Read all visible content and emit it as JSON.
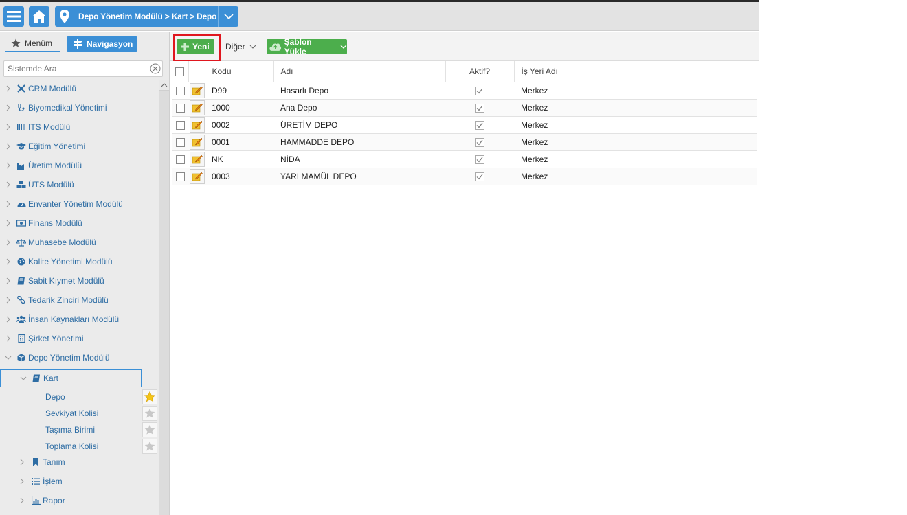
{
  "topbar": {
    "breadcrumb": "Depo Yönetim Modülü > Kart > Depo"
  },
  "sidebar": {
    "tab_menu": "Menüm",
    "tab_nav": "Navigasyon",
    "search_placeholder": "Sistemde Ara",
    "modules": [
      {
        "label": "CRM Modülü",
        "icon": "crm-icon"
      },
      {
        "label": "Biyomedikal Yönetimi",
        "icon": "stethoscope-icon"
      },
      {
        "label": "ITS Modülü",
        "icon": "barcode-icon"
      },
      {
        "label": "Eğitim Yönetimi",
        "icon": "graduation-cap-icon"
      },
      {
        "label": "Üretim Modülü",
        "icon": "factory-icon"
      },
      {
        "label": "ÜTS Modülü",
        "icon": "cubes-icon"
      },
      {
        "label": "Envanter Yönetim Modülü",
        "icon": "dashboard-icon"
      },
      {
        "label": "Finans Modülü",
        "icon": "money-icon"
      },
      {
        "label": "Muhasebe Modülü",
        "icon": "balance-scale-icon"
      },
      {
        "label": "Kalite Yönetimi Modülü",
        "icon": "globe-icon"
      },
      {
        "label": "Sabit Kıymet Modülü",
        "icon": "book-icon"
      },
      {
        "label": "Tedarik Zinciri Modülü",
        "icon": "link-icon"
      },
      {
        "label": "İnsan Kaynakları Modülü",
        "icon": "users-icon"
      },
      {
        "label": "Şirket Yönetimi",
        "icon": "building-icon"
      },
      {
        "label": "Depo Yönetim Modülü",
        "icon": "cube-icon"
      }
    ],
    "kart_label": "Kart",
    "kart_items": [
      "Depo",
      "Sevkiyat Kolisi",
      "Taşıma Birimi",
      "Toplama Kolisi"
    ],
    "sub_sections": [
      {
        "label": "Tanım",
        "icon": "bookmark-icon"
      },
      {
        "label": "İşlem",
        "icon": "list-icon"
      },
      {
        "label": "Rapor",
        "icon": "bar-chart-icon"
      }
    ]
  },
  "toolbar": {
    "new_label": "Yeni",
    "other_label": "Diğer",
    "template_label": "Şablon Yükle"
  },
  "table": {
    "headers": {
      "code": "Kodu",
      "name": "Adı",
      "active": "Aktif?",
      "workplace": "İş Yeri Adı"
    },
    "rows": [
      {
        "code": "D99",
        "name": "Hasarlı Depo",
        "active": true,
        "workplace": "Merkez"
      },
      {
        "code": "1000",
        "name": "Ana Depo",
        "active": true,
        "workplace": "Merkez"
      },
      {
        "code": "0002",
        "name": "ÜRETİM DEPO",
        "active": true,
        "workplace": "Merkez"
      },
      {
        "code": "0001",
        "name": "HAMMADDE DEPO",
        "active": true,
        "workplace": "Merkez"
      },
      {
        "code": "NK",
        "name": "NİDA",
        "active": true,
        "workplace": "Merkez"
      },
      {
        "code": "0003",
        "name": "YARI MAMÜL DEPO",
        "active": true,
        "workplace": "Merkez"
      }
    ]
  },
  "colors": {
    "primary": "#3b8fd6",
    "success": "#4cae4c",
    "highlight": "#e0161e",
    "link": "#2e6da4"
  }
}
